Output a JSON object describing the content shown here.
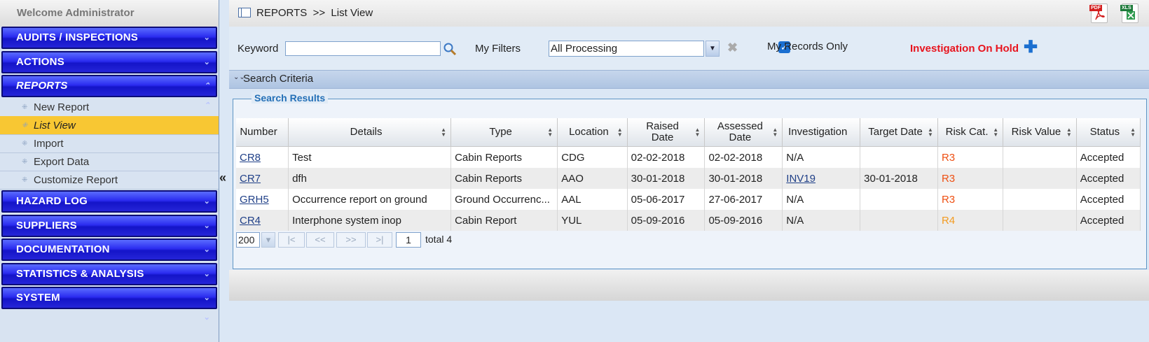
{
  "sidebar": {
    "welcome": "Welcome  Administrator",
    "sections": [
      {
        "label": "AUDITS / INSPECTIONS"
      },
      {
        "label": "ACTIONS"
      },
      {
        "label": "REPORTS"
      },
      {
        "label": "HAZARD LOG"
      },
      {
        "label": "SUPPLIERS"
      },
      {
        "label": "DOCUMENTATION"
      },
      {
        "label": "STATISTICS & ANALYSIS"
      },
      {
        "label": "SYSTEM"
      }
    ],
    "report_items": [
      {
        "label": "New Report"
      },
      {
        "label": "List View"
      },
      {
        "label": "Import"
      },
      {
        "label": "Export Data"
      },
      {
        "label": "Customize Report"
      }
    ],
    "active_item": "List View",
    "nav_color": "#2b2cf0",
    "active_color": "#f8c733"
  },
  "header": {
    "breadcrumb": "REPORTS  >>  List View",
    "export_icons": [
      "pdf-export-icon",
      "excel-export-icon"
    ]
  },
  "filters": {
    "keyword_label": "Keyword",
    "keyword_value": "",
    "my_filters_label": "My Filters",
    "my_filters_value": "All Processing",
    "my_records_label": "My Records Only",
    "my_records_checked": true,
    "hold_label": "Investigation On Hold"
  },
  "criteria": {
    "label": "Search Criteria"
  },
  "results": {
    "legend": "Search Results",
    "columns": [
      {
        "label": "Number",
        "sortable": false
      },
      {
        "label": "Details",
        "sortable": true
      },
      {
        "label": "Type",
        "sortable": true
      },
      {
        "label": "Location",
        "sortable": true
      },
      {
        "label": "Raised Date",
        "sortable": true
      },
      {
        "label": "Assessed Date",
        "sortable": true
      },
      {
        "label": "Investigation",
        "sortable": false
      },
      {
        "label": "Target Date",
        "sortable": true
      },
      {
        "label": "Risk Cat.",
        "sortable": true
      },
      {
        "label": "Risk Value",
        "sortable": true
      },
      {
        "label": "Status",
        "sortable": true
      }
    ],
    "rows": [
      {
        "number": "CR8",
        "details": "Test",
        "type": "Cabin Reports",
        "location": "CDG",
        "raised": "02-02-2018",
        "assessed": "02-02-2018",
        "investigation": "N/A",
        "target": "",
        "risk_cat": "R3",
        "risk_value": "",
        "status": "Accepted"
      },
      {
        "number": "CR7",
        "details": "dfh",
        "type": "Cabin Reports",
        "location": "AAO",
        "raised": "30-01-2018",
        "assessed": "30-01-2018",
        "investigation": "INV19",
        "target": "30-01-2018",
        "risk_cat": "R3",
        "risk_value": "",
        "status": "Accepted"
      },
      {
        "number": "GRH5",
        "details": "Occurrence report on ground",
        "type": "Ground Occurrenc...",
        "location": "AAL",
        "raised": "05-06-2017",
        "assessed": "27-06-2017",
        "investigation": "N/A",
        "target": "",
        "risk_cat": "R3",
        "risk_value": "",
        "status": "Accepted"
      },
      {
        "number": "CR4",
        "details": "Interphone system inop",
        "type": "Cabin Report",
        "location": "YUL",
        "raised": "05-09-2016",
        "assessed": "05-09-2016",
        "investigation": "N/A",
        "target": "",
        "risk_cat": "R4",
        "risk_value": "",
        "status": "Accepted"
      }
    ],
    "pager": {
      "page_size": "200",
      "first": "|<",
      "prev": "<<",
      "next": ">>",
      "last": ">|",
      "page": "1",
      "total_label": "total",
      "total": "4"
    }
  }
}
